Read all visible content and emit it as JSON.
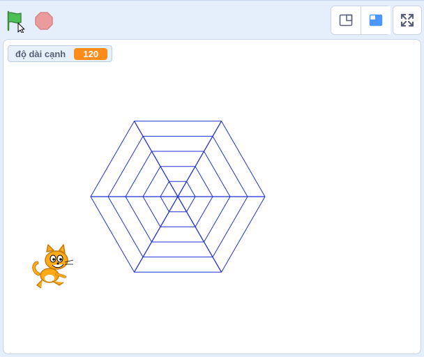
{
  "toolbar": {
    "green_flag_icon": "green-flag-icon",
    "stop_icon": "stop-sign-icon",
    "layout_modes": [
      {
        "name": "small-stage-icon",
        "active": false
      },
      {
        "name": "normal-stage-icon",
        "active": true
      },
      {
        "name": "fullscreen-icon",
        "active": false
      }
    ]
  },
  "monitor": {
    "label": "độ dài cạnh",
    "value": "120"
  },
  "colors": {
    "pen": "#1f2fd6",
    "flag": "#4cbf56",
    "stop": "#ec9b9d",
    "monitor_value_bg": "#ff8c1a",
    "accent": "#4c97ff"
  },
  "drawing": {
    "shape": "hexagon-web",
    "rings": 5,
    "spokes": 6
  },
  "sprite": {
    "name": "cat-sprite"
  }
}
